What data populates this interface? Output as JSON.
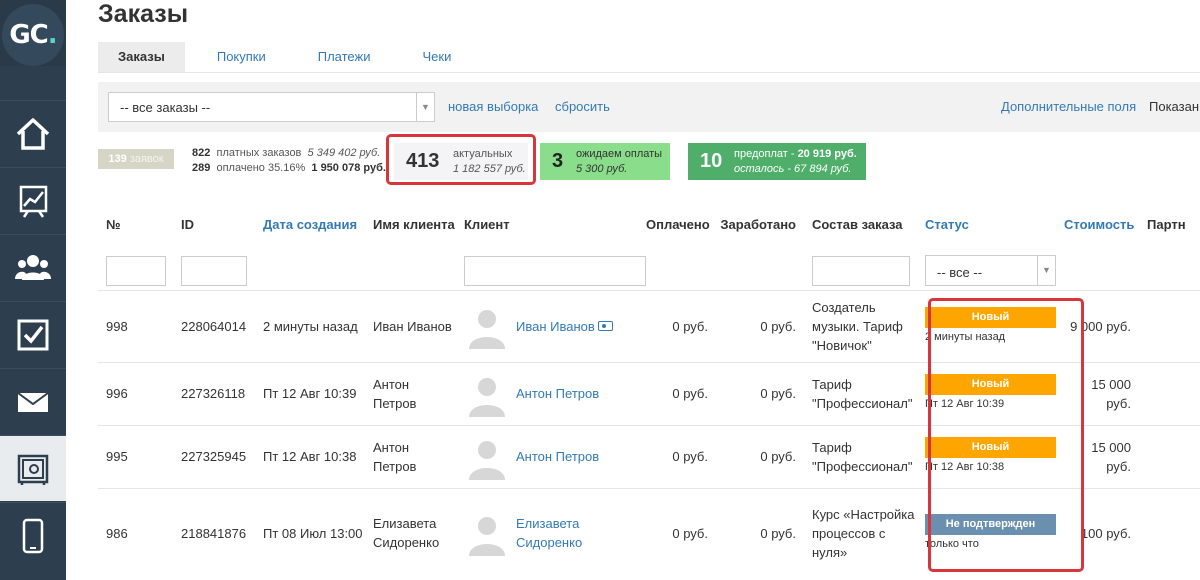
{
  "logo": {
    "text_main": "GC",
    "text_dot": "."
  },
  "sidebar": {
    "items": [
      {
        "icon": "home-icon"
      },
      {
        "icon": "chart-icon"
      },
      {
        "icon": "users-icon"
      },
      {
        "icon": "checkbox-icon"
      },
      {
        "icon": "mail-icon"
      },
      {
        "icon": "safe-icon",
        "active": true
      },
      {
        "icon": "phone-icon"
      }
    ]
  },
  "page": {
    "title": "Заказы"
  },
  "tabs": [
    {
      "label": "Заказы",
      "active": true
    },
    {
      "label": "Покупки"
    },
    {
      "label": "Платежи"
    },
    {
      "label": "Чеки"
    }
  ],
  "filter_bar": {
    "select_value": "-- все заказы --",
    "new_selection": "новая выборка",
    "reset": "сбросить",
    "extra_fields": "Дополнительные поля",
    "shown": "Показан"
  },
  "stats": {
    "orders_count": "139",
    "orders_label": "заявок",
    "paid_count": "822",
    "paid_label": "платных заказов",
    "paid_sum": "5 349 402 руб.",
    "paid_done_count": "289",
    "paid_done_label": "оплачено 35.16%",
    "paid_done_sum": "1 950 078 руб.",
    "actual_count": "413",
    "actual_label": "актуальных",
    "actual_sum": "1 182 557 руб.",
    "wait_count": "3",
    "wait_label": "ожидаем оплаты",
    "wait_sum": "5 300 руб.",
    "prepay_count": "10",
    "prepay_label": "предоплат - ",
    "prepay_sum": "20 919 руб.",
    "remain_label": "осталось - ",
    "remain_sum": "67 894 руб."
  },
  "colors": {
    "accent": "#337ab7",
    "status_new": "#ffa500",
    "status_unconfirmed": "#6b8fae",
    "highlight": "#d8363b",
    "sidebar": "#2d3e4f"
  },
  "table": {
    "headers": {
      "no": "№",
      "id": "ID",
      "created": "Дата создания",
      "client_name": "Имя клиента",
      "client": "Клиент",
      "paid": "Оплачено",
      "earned": "Заработано",
      "composition": "Состав заказа",
      "status": "Статус",
      "cost": "Стоимость",
      "partner": "Партн"
    },
    "status_filter": "-- все --",
    "rows": [
      {
        "no": "998",
        "id": "228064014",
        "created": "2 минуты назад",
        "name": "Иван Иванов",
        "client": "Иван Иванов",
        "paid": "0 руб.",
        "earned": "0 руб.",
        "composition": "Создатель музыки. Тариф \"Новичок\"",
        "status": "Новый",
        "status_time": "2 минуты назад",
        "cost": "9 000 руб."
      },
      {
        "no": "996",
        "id": "227326118",
        "created": "Пт 12 Авг 10:39",
        "name": "Антон Петров",
        "client": "Антон Петров",
        "paid": "0 руб.",
        "earned": "0 руб.",
        "composition": "Тариф \"Профессионал\"",
        "status": "Новый",
        "status_time": "Пт 12 Авг 10:39",
        "cost": "15 000 руб."
      },
      {
        "no": "995",
        "id": "227325945",
        "created": "Пт 12 Авг 10:38",
        "name": "Антон Петров",
        "client": "Антон Петров",
        "paid": "0 руб.",
        "earned": "0 руб.",
        "composition": "Тариф \"Профессионал\"",
        "status": "Новый",
        "status_time": "Пт 12 Авг 10:38",
        "cost": "15 000 руб."
      },
      {
        "no": "986",
        "id": "218841876",
        "created": "Пт 08 Июл 13:00",
        "name": "Елизавета Сидоренко",
        "client": "Елизавета Сидоренко",
        "paid": "0 руб.",
        "earned": "0 руб.",
        "composition": "Курс «Настройка процессов с нуля»",
        "status": "Не подтвержден",
        "status_time": "только что",
        "cost": "100 руб."
      }
    ]
  }
}
